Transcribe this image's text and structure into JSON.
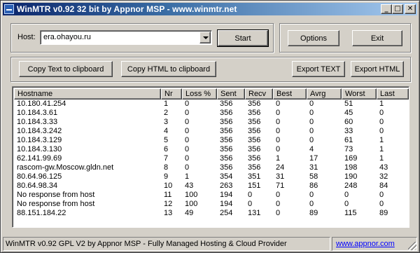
{
  "window": {
    "title": "WinMTR v0.92 32 bit by Appnor MSP - www.winmtr.net",
    "minimize_glyph": "_",
    "maximize_glyph": "□",
    "close_glyph": "✕"
  },
  "host": {
    "label": "Host:",
    "value": "era.ohayou.ru"
  },
  "buttons": {
    "start": "Start",
    "options": "Options",
    "exit": "Exit",
    "copy_text": "Copy Text to clipboard",
    "copy_html": "Copy HTML to clipboard",
    "export_text": "Export TEXT",
    "export_html": "Export HTML"
  },
  "table": {
    "columns": [
      "Hostname",
      "Nr",
      "Loss %",
      "Sent",
      "Recv",
      "Best",
      "Avrg",
      "Worst",
      "Last"
    ],
    "rows": [
      [
        "10.180.41.254",
        "1",
        "0",
        "356",
        "356",
        "0",
        "0",
        "51",
        "1"
      ],
      [
        "10.184.3.61",
        "2",
        "0",
        "356",
        "356",
        "0",
        "0",
        "45",
        "0"
      ],
      [
        "10.184.3.33",
        "3",
        "0",
        "356",
        "356",
        "0",
        "0",
        "60",
        "0"
      ],
      [
        "10.184.3.242",
        "4",
        "0",
        "356",
        "356",
        "0",
        "0",
        "33",
        "0"
      ],
      [
        "10.184.3.129",
        "5",
        "0",
        "356",
        "356",
        "0",
        "0",
        "61",
        "1"
      ],
      [
        "10.184.3.130",
        "6",
        "0",
        "356",
        "356",
        "0",
        "4",
        "73",
        "1"
      ],
      [
        "62.141.99.69",
        "7",
        "0",
        "356",
        "356",
        "1",
        "17",
        "169",
        "1"
      ],
      [
        "rascom-gw.Moscow.gldn.net",
        "8",
        "0",
        "356",
        "356",
        "24",
        "31",
        "198",
        "43"
      ],
      [
        "80.64.96.125",
        "9",
        "1",
        "354",
        "351",
        "31",
        "58",
        "190",
        "32"
      ],
      [
        "80.64.98.34",
        "10",
        "43",
        "263",
        "151",
        "71",
        "86",
        "248",
        "84"
      ],
      [
        "No response from host",
        "11",
        "100",
        "194",
        "0",
        "0",
        "0",
        "0",
        "0"
      ],
      [
        "No response from host",
        "12",
        "100",
        "194",
        "0",
        "0",
        "0",
        "0",
        "0"
      ],
      [
        "88.151.184.22",
        "13",
        "49",
        "254",
        "131",
        "0",
        "89",
        "115",
        "89"
      ]
    ]
  },
  "statusbar": {
    "text": "WinMTR v0.92 GPL V2 by Appnor MSP - Fully Managed Hosting & Cloud Provider",
    "link": "www.appnor.com"
  }
}
